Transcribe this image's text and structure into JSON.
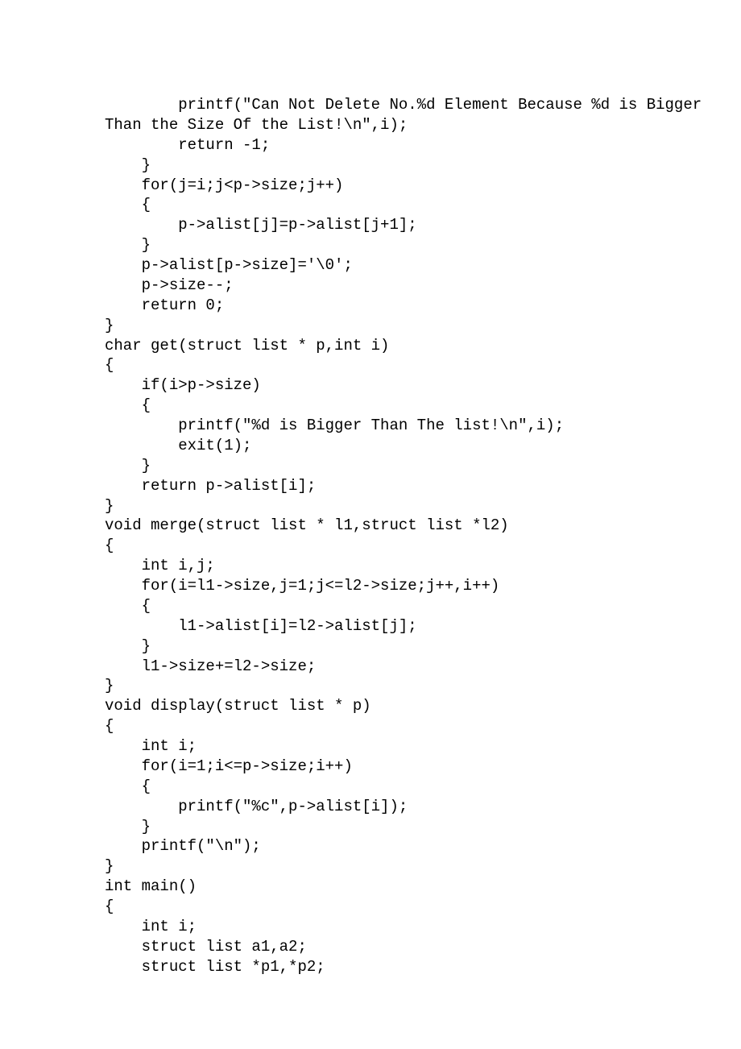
{
  "code": "        printf(\"Can Not Delete No.%d Element Because %d is Bigger\nThan the Size Of the List!\\n\",i);\n        return -1;\n    }\n    for(j=i;j<p->size;j++)\n    {\n        p->alist[j]=p->alist[j+1];\n    }\n    p->alist[p->size]='\\0';\n    p->size--;\n    return 0;\n}\nchar get(struct list * p,int i)\n{\n    if(i>p->size)\n    {\n        printf(\"%d is Bigger Than The list!\\n\",i);\n        exit(1);\n    }\n    return p->alist[i];\n}\nvoid merge(struct list * l1,struct list *l2)\n{\n    int i,j;\n    for(i=l1->size,j=1;j<=l2->size;j++,i++)\n    {\n        l1->alist[i]=l2->alist[j];\n    }\n    l1->size+=l2->size;\n}\nvoid display(struct list * p)\n{\n    int i;\n    for(i=1;i<=p->size;i++)\n    {\n        printf(\"%c\",p->alist[i]);\n    }\n    printf(\"\\n\");\n}\nint main()\n{\n    int i;\n    struct list a1,a2;\n    struct list *p1,*p2;"
}
